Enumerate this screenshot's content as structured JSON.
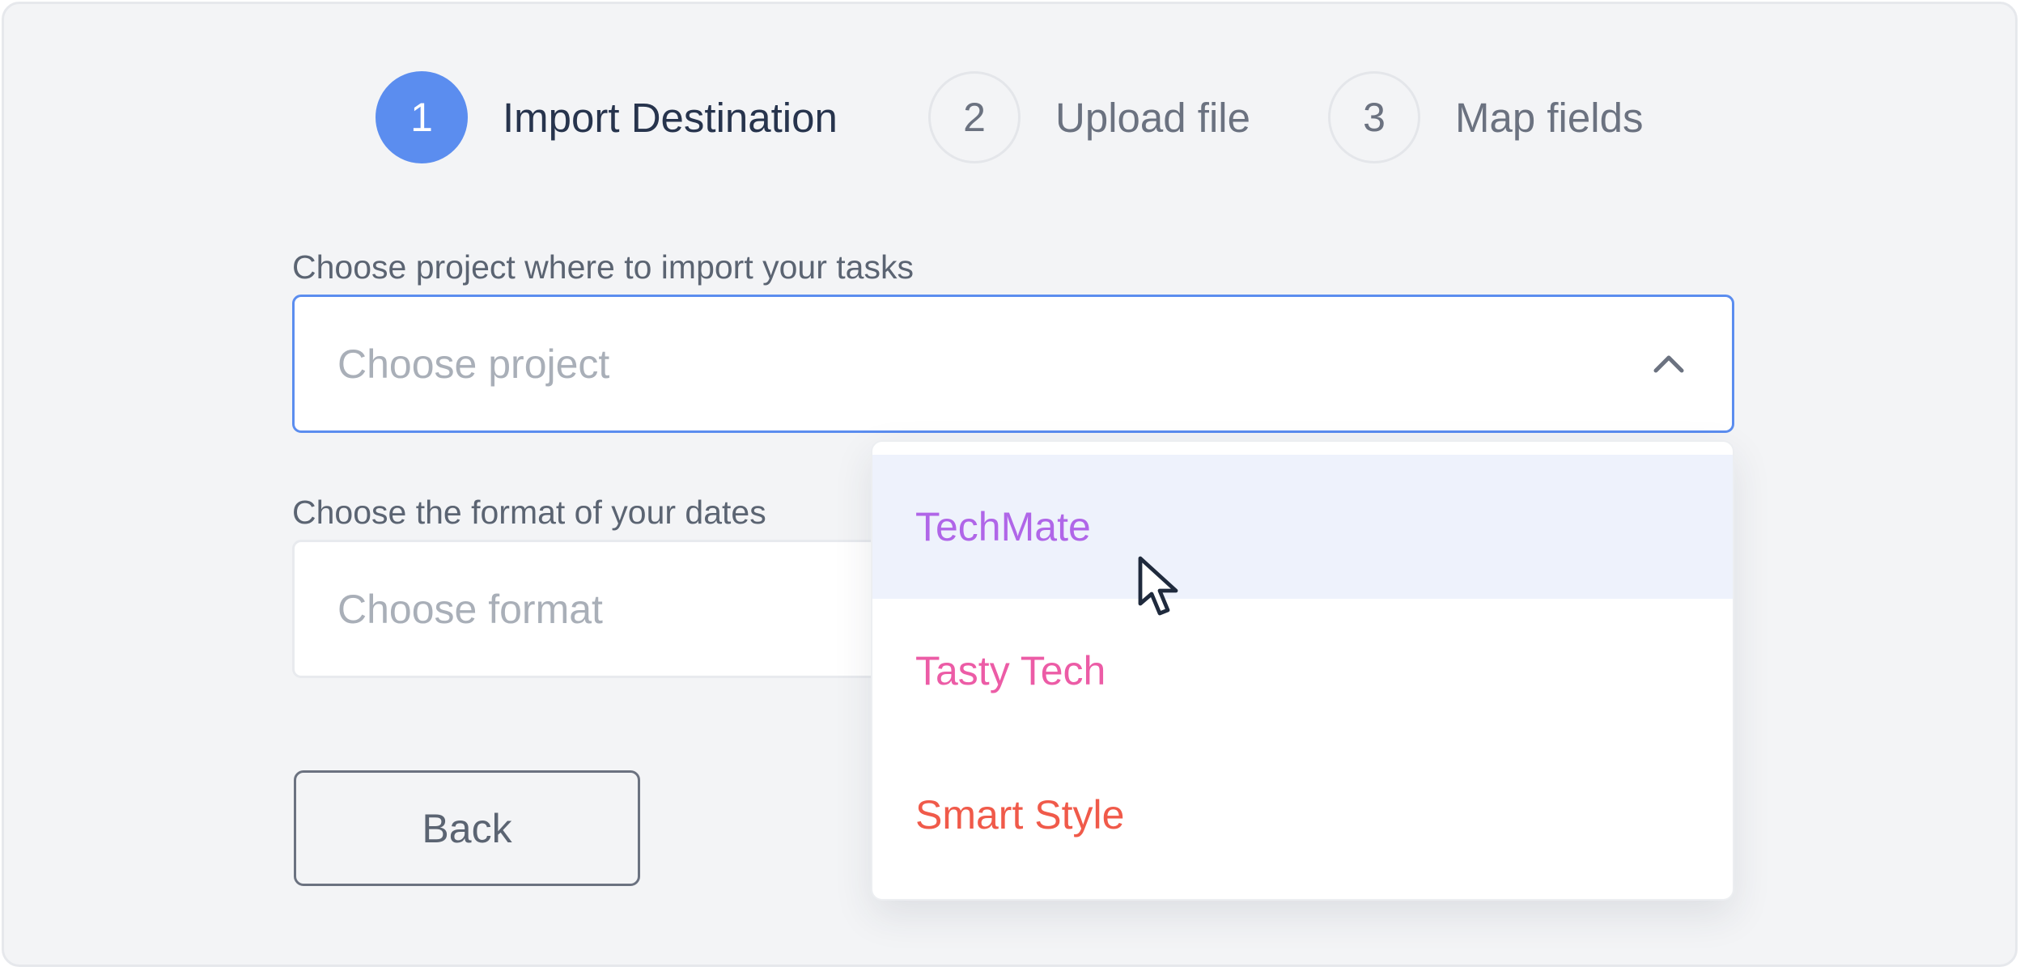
{
  "stepper": {
    "steps": [
      {
        "number": "1",
        "label": "Import Destination",
        "active": true
      },
      {
        "number": "2",
        "label": "Upload file",
        "active": false
      },
      {
        "number": "3",
        "label": "Map fields",
        "active": false
      }
    ]
  },
  "project_field": {
    "label": "Choose project where to import your tasks",
    "placeholder": "Choose project",
    "open": true
  },
  "format_field": {
    "label": "Choose the format of your dates",
    "placeholder": "Choose format"
  },
  "back_button": {
    "label": "Back"
  },
  "project_dropdown": {
    "options": [
      {
        "label": "TechMate",
        "color": "#b066e8",
        "highlighted": true
      },
      {
        "label": "Tasty Tech",
        "color": "#ec5ca6",
        "highlighted": false
      },
      {
        "label": "Smart Style",
        "color": "#f05a4a",
        "highlighted": false
      }
    ]
  },
  "colors": {
    "accent": "#5b8def",
    "background": "#f3f4f6"
  }
}
